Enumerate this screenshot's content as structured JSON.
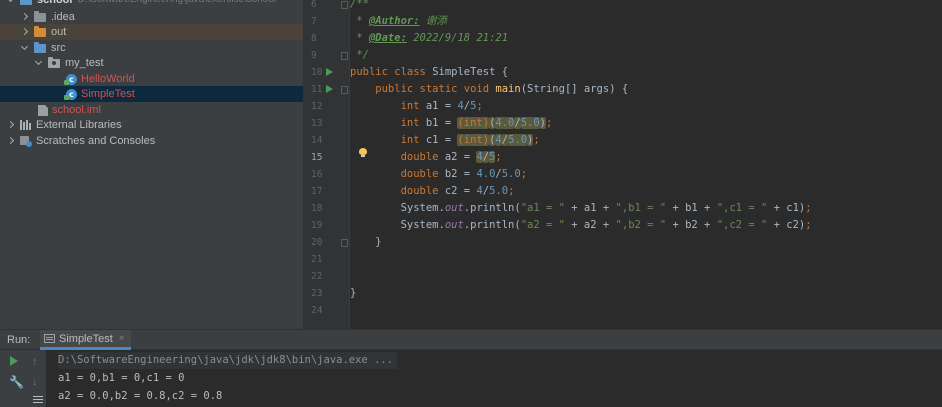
{
  "project_tree": {
    "root": {
      "name": "school",
      "path": "D:\\SoftwareEngineering\\java\\exercise\\school"
    },
    "items": [
      {
        "label": ".idea"
      },
      {
        "label": "out"
      },
      {
        "label": "src"
      },
      {
        "label": "my_test"
      },
      {
        "label": "HelloWorld"
      },
      {
        "label": "SimpleTest"
      },
      {
        "label": "school.iml"
      },
      {
        "label": "External Libraries"
      },
      {
        "label": "Scratches and Consoles"
      }
    ]
  },
  "editor": {
    "line_numbers": [
      "6",
      "7",
      "8",
      "9",
      "10",
      "11",
      "12",
      "13",
      "14",
      "15",
      "16",
      "17",
      "18",
      "19",
      "20",
      "21",
      "22",
      "23",
      "24"
    ],
    "current_line": "15",
    "lines": [
      [
        {
          "t": "/**",
          "c": "doc"
        }
      ],
      [
        {
          "t": " * ",
          "c": "doc"
        },
        {
          "t": "@Author:",
          "c": "tag"
        },
        {
          "t": " 谢添",
          "c": "doc"
        }
      ],
      [
        {
          "t": " * ",
          "c": "doc"
        },
        {
          "t": "@Date:",
          "c": "tag"
        },
        {
          "t": " 2022/9/18 21:21",
          "c": "doc"
        }
      ],
      [
        {
          "t": " */",
          "c": "doc"
        }
      ],
      [
        {
          "t": "public class ",
          "c": "kw"
        },
        {
          "t": "SimpleTest {",
          "c": ""
        }
      ],
      [
        {
          "t": "    public static void ",
          "c": "kw"
        },
        {
          "t": "main",
          "c": "fn"
        },
        {
          "t": "(String[] args) {",
          "c": ""
        }
      ],
      [
        {
          "t": "        int ",
          "c": "kw"
        },
        {
          "t": "a1 = ",
          "c": ""
        },
        {
          "t": "4",
          "c": "num"
        },
        {
          "t": "/",
          "c": ""
        },
        {
          "t": "5",
          "c": "num"
        },
        {
          "t": ";",
          "c": "kw"
        }
      ],
      [
        {
          "t": "        int ",
          "c": "kw"
        },
        {
          "t": "b1 = ",
          "c": ""
        },
        {
          "t": "(int)",
          "c": "kw hl"
        },
        {
          "t": "(",
          "c": "hl"
        },
        {
          "t": "4.0",
          "c": "num hl"
        },
        {
          "t": "/",
          "c": "hl"
        },
        {
          "t": "5.0",
          "c": "num hl"
        },
        {
          "t": ")",
          "c": "hl"
        },
        {
          "t": ";",
          "c": "kw"
        }
      ],
      [
        {
          "t": "        int ",
          "c": "kw"
        },
        {
          "t": "c1 = ",
          "c": ""
        },
        {
          "t": "(int)",
          "c": "kw hl"
        },
        {
          "t": "(",
          "c": "hl"
        },
        {
          "t": "4",
          "c": "num hl"
        },
        {
          "t": "/",
          "c": "hl"
        },
        {
          "t": "5.0",
          "c": "num hl"
        },
        {
          "t": ")",
          "c": "hl"
        },
        {
          "t": ";",
          "c": "kw"
        }
      ],
      [
        {
          "t": "        double ",
          "c": "kw"
        },
        {
          "t": "a2 = ",
          "c": ""
        },
        {
          "t": "4",
          "c": "num hl"
        },
        {
          "t": "/",
          "c": "hl"
        },
        {
          "t": "5",
          "c": "num hl"
        },
        {
          "t": ";",
          "c": "kw"
        }
      ],
      [
        {
          "t": "        double ",
          "c": "kw"
        },
        {
          "t": "b2 = ",
          "c": ""
        },
        {
          "t": "4.0",
          "c": "num"
        },
        {
          "t": "/",
          "c": ""
        },
        {
          "t": "5.0",
          "c": "num"
        },
        {
          "t": ";",
          "c": "kw"
        }
      ],
      [
        {
          "t": "        double ",
          "c": "kw"
        },
        {
          "t": "c2 = ",
          "c": ""
        },
        {
          "t": "4",
          "c": "num"
        },
        {
          "t": "/",
          "c": ""
        },
        {
          "t": "5.0",
          "c": "num"
        },
        {
          "t": ";",
          "c": "kw"
        }
      ],
      [
        {
          "t": "        System.",
          "c": ""
        },
        {
          "t": "out",
          "c": "fld"
        },
        {
          "t": ".println(",
          "c": ""
        },
        {
          "t": "\"a1 = \"",
          "c": "str"
        },
        {
          "t": " + a1 + ",
          "c": ""
        },
        {
          "t": "\",b1 = \"",
          "c": "str"
        },
        {
          "t": " + b1 + ",
          "c": ""
        },
        {
          "t": "\",c1 = \"",
          "c": "str"
        },
        {
          "t": " + c1)",
          "c": ""
        },
        {
          "t": ";",
          "c": "kw"
        }
      ],
      [
        {
          "t": "        System.",
          "c": ""
        },
        {
          "t": "out",
          "c": "fld"
        },
        {
          "t": ".println(",
          "c": ""
        },
        {
          "t": "\"a2 = \"",
          "c": "str"
        },
        {
          "t": " + a2 + ",
          "c": ""
        },
        {
          "t": "\",b2 = \"",
          "c": "str"
        },
        {
          "t": " + b2 + ",
          "c": ""
        },
        {
          "t": "\",c2 = \"",
          "c": "str"
        },
        {
          "t": " + c2)",
          "c": ""
        },
        {
          "t": ";",
          "c": "kw"
        }
      ],
      [
        {
          "t": "    }",
          "c": ""
        }
      ],
      [
        {
          "t": "",
          "c": ""
        }
      ],
      [
        {
          "t": "",
          "c": ""
        }
      ],
      [
        {
          "t": "}",
          "c": ""
        }
      ],
      [
        {
          "t": "",
          "c": ""
        }
      ]
    ]
  },
  "run_panel": {
    "label": "Run:",
    "tab": {
      "label": "SimpleTest",
      "close": "×"
    },
    "output": [
      "D:\\SoftwareEngineering\\java\\jdk\\jdk8\\bin\\java.exe ...",
      "a1 = 0,b1 = 0,c1 = 0",
      "a2 = 0.0,b2 = 0.8,c2 = 0.8"
    ]
  },
  "icons": {
    "up": "↑",
    "down": "↓",
    "wrench": "🔧"
  },
  "colors": {
    "keyword": "#cc7832",
    "string": "#6a8759",
    "number": "#6897bb",
    "selection": "#0d293e",
    "run": "#499c54"
  }
}
